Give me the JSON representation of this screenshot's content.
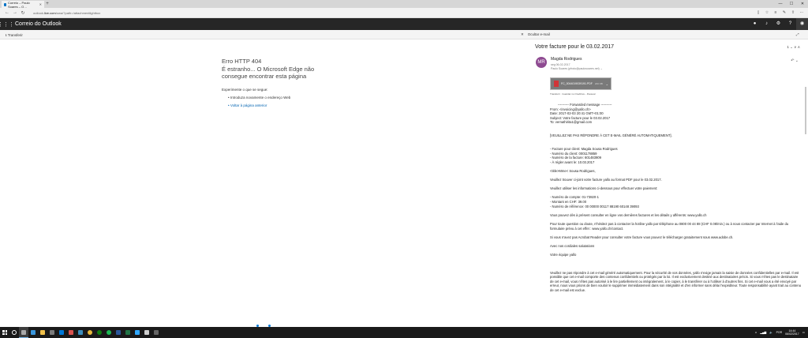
{
  "browser": {
    "tab_title": "Correio – Paulo Soares – O…",
    "url_prefix": "outlook.",
    "url_host": "live.com",
    "url_path": "/owa/?path=/attachmentlightbox"
  },
  "app": {
    "title": "Correio do Outlook"
  },
  "command_bar": {
    "download_label": "Transferir",
    "hide_email_label": "Ocultar e-mail"
  },
  "error": {
    "title": "Erro HTTP 404",
    "message": "É estranho... O Microsoft Edge não consegue encontrar esta página",
    "try_label": "Experimente o que se segue:",
    "options": [
      "Introduza novamente o endereço Web",
      "Voltar à página anterior"
    ]
  },
  "email": {
    "subject": "Votre facture pour le 03.02.2017",
    "header_actions": "1 ⌄  ∨  ∧",
    "sender_initials": "MR",
    "sender_name": "Magda Rodrigues",
    "sent_date": "seg 06-02-2017",
    "recipients": "Paulo Soares (pfroto@paulosoares.net) ⌄",
    "attachment": {
      "name": "FC_0044019039191.PDF",
      "size": "240 KB",
      "actions": "Transferir · Guardar no OneDrive - Pessoal"
    },
    "body": [
      {
        "t": "---------- Forwarded message ----------",
        "c": "center"
      },
      {
        "t": "From: <invoicing@yallo.ch>"
      },
      {
        "t": "Date: 2017-02-03 20:41 GMT+01:00"
      },
      {
        "t": "Subject: Votre facture pour le 03.02.2017"
      },
      {
        "t": "To: vernathirita1@gmail.com"
      },
      {
        "t": ""
      },
      {
        "t": ""
      },
      {
        "t": "[VEUILLEZ NE PAS RÉPONDRE À CET E-MAIL GÉNÉRÉ AUTOMATIQUEMENT]."
      },
      {
        "t": ""
      },
      {
        "t": ""
      },
      {
        "t": "- Facture pour client: Magda Sousa Rodrigues"
      },
      {
        "t": "- Numéro du client: 0001178859"
      },
      {
        "t": "- Numéro de la facture: 601483909"
      },
      {
        "t": "- À régler avant le: 10.03.2017"
      },
      {
        "t": ""
      },
      {
        "t": "<title>Mme< Sousa Rodrigues,"
      },
      {
        "t": ""
      },
      {
        "t": "Veuillez trouver ci-joint votre facture yallo au format PDF pour le 03.02.2017."
      },
      {
        "t": ""
      },
      {
        "t": "Veuillez utiliser les informations ci-dessous pour effectuer votre paiement:"
      },
      {
        "t": ""
      },
      {
        "t": "- Numéro de compte: 01-73820-1"
      },
      {
        "t": "- Montant en CHF: 39.00"
      },
      {
        "t": "- Numéro de référence: 00 00000 00117 88190 60148 39093"
      },
      {
        "t": ""
      },
      {
        "t": "Vous pouvez dès à présent consulter en ligne vos dernières factures et les détails y afférents: www.yallo.ch"
      },
      {
        "t": ""
      },
      {
        "t": "Pour toute question ou doute, n'hésitez pas à contacter la hotline yallo par téléphone au 0800 00 44 88 (CHF 0.08/min.) ou à nous contacter par Internet à l'aide du formulaire prévu à cet effet : www.yallo.ch/contact."
      },
      {
        "t": ""
      },
      {
        "t": "Si vous n'avez pas Acrobat Reader pour consulter votre facture vous pouvez le télécharger gratuitement sous www.adobe.ch."
      },
      {
        "t": ""
      },
      {
        "t": "Avec nos cordiales salutations"
      },
      {
        "t": ""
      },
      {
        "t": "Votre équipe yallo"
      },
      {
        "t": ""
      },
      {
        "t": ""
      },
      {
        "t": ""
      },
      {
        "t": "Veuillez ne pas répondre à cet e-mail généré automatiquement. Pour la sécurité de vos données, yallo n'exige jamais la saisie de données confidentielles par e-mail. Il est possible que cet e-mail comporte des contenus confidentiels ou protégés par la loi. Il est exclusivement destiné aux destinataires précis. Si vous n'êtes pas le destinataire de cet e-mail, vous n'êtes pas autorisé à le lire partiellement ou intégralement, à le copier, à le transférer ou à l'utiliser à d'autres fins. Si cet e-mail vous a été envoyé par erreur, nous vous prions de bien vouloir le supprimer immédiatement dans son intégralité et d'en informer sans délai l'expéditeur. Toute responsabilité ayant trait au contenu de cet e-mail est exclue."
      }
    ]
  },
  "taskbar": {
    "lang": "POR",
    "time": "14:44",
    "date": "06/02/2017"
  },
  "colors": {
    "accent": "#0078d7",
    "appbar": "#262626",
    "avatar": "#8e4a91"
  }
}
